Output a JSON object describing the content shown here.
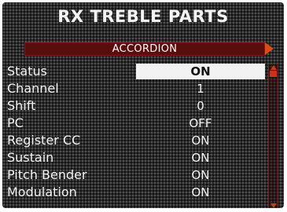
{
  "header": {
    "title": "RX TREBLE PARTS"
  },
  "part_selector": {
    "value": "ACCORDION"
  },
  "params": [
    {
      "label": "Status",
      "value": "ON"
    },
    {
      "label": "Channel",
      "value": "1"
    },
    {
      "label": "Shift",
      "value": "0"
    },
    {
      "label": "PC",
      "value": "OFF"
    },
    {
      "label": "Register CC",
      "value": "ON"
    },
    {
      "label": "Sustain",
      "value": "ON"
    },
    {
      "label": "Pitch Bender",
      "value": "ON"
    },
    {
      "label": "Modulation",
      "value": "ON"
    }
  ],
  "colors": {
    "background": "#2a2a2a",
    "accent": "#e04a1a",
    "selector_bg": "#5a0d0d",
    "selected_value_bg": "#f2f2f2"
  },
  "icons": {
    "next": "right-arrow-icon",
    "scroll_up": "scroll-up-icon",
    "scroll_down": "scroll-down-icon"
  }
}
